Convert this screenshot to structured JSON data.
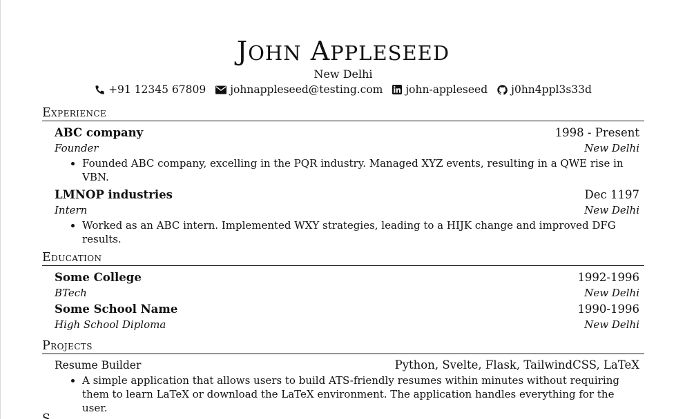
{
  "header": {
    "name_first_initial": "J",
    "name_first_rest": "ohn",
    "name_last_initial": "A",
    "name_last_rest": "ppleseed",
    "location": "New Delhi",
    "contacts": {
      "phone": "+91 12345 67809",
      "email": "johnappleseed@testing.com",
      "linkedin": "john-appleseed",
      "github": "j0hn4ppl3s33d"
    },
    "icons": {
      "phone": "phone-icon",
      "email": "envelope-icon",
      "linkedin": "linkedin-icon",
      "github": "github-icon"
    }
  },
  "experience": {
    "title": "Experience",
    "items": [
      {
        "org": "ABC company",
        "date": "1998 - Present",
        "role": "Founder",
        "location": "New Delhi",
        "bullets": [
          "Founded ABC company, excelling in the PQR industry. Managed XYZ events, resulting in a QWE rise in VBN."
        ]
      },
      {
        "org": "LMNOP industries",
        "date": "Dec 1197",
        "role": "Intern",
        "location": "New Delhi",
        "bullets": [
          "Worked as an ABC intern. Implemented WXY strategies, leading to a HIJK change and improved DFG results."
        ]
      }
    ]
  },
  "education": {
    "title": "Education",
    "items": [
      {
        "school": "Some College",
        "date": "1992-1996",
        "degree": "BTech",
        "location": "New Delhi"
      },
      {
        "school": "Some School Name",
        "date": "1990-1996",
        "degree": "High School Diploma",
        "location": "New Delhi"
      }
    ]
  },
  "projects": {
    "title": "Projects",
    "items": [
      {
        "name": "Resume Builder",
        "tech": "Python, Svelte, Flask, TailwindCSS, LaTeX",
        "bullets": [
          "A simple application that allows users to build ATS-friendly resumes within minutes without requiring them to learn LaTeX or download the LaTeX environment. The application handles everything for the user."
        ]
      }
    ]
  },
  "next_section_partial": "S"
}
